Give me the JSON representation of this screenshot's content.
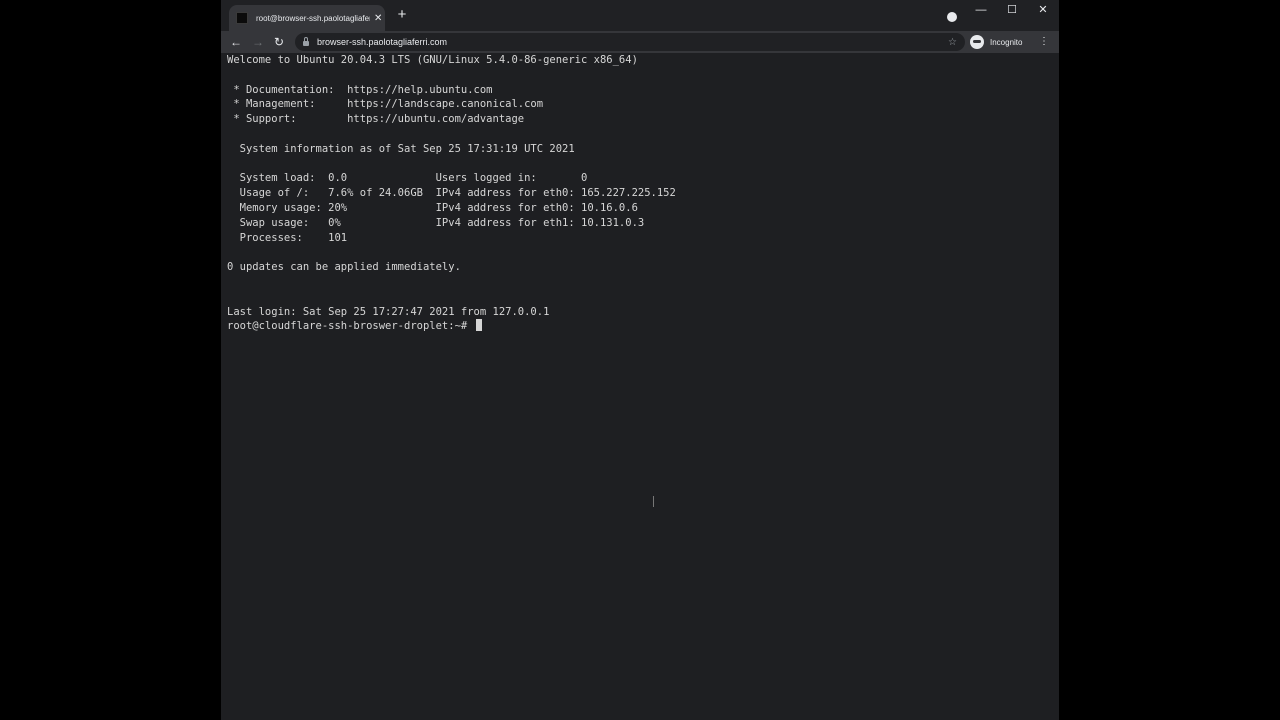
{
  "browser": {
    "tab_title": "root@browser-ssh.paolotagliaferri.com",
    "tab_close": "✕",
    "new_tab": "+",
    "url": "browser-ssh.paolotagliaferri.com",
    "incognito_label": "Incognito",
    "window_minimize": "—",
    "window_maximize": "☐",
    "window_close": "✕",
    "back": "←",
    "forward": "→",
    "reload": "↻",
    "star": "☆",
    "menu": "⋮"
  },
  "terminal": {
    "lines": [
      "Welcome to Ubuntu 20.04.3 LTS (GNU/Linux 5.4.0-86-generic x86_64)",
      "",
      " * Documentation:  https://help.ubuntu.com",
      " * Management:     https://landscape.canonical.com",
      " * Support:        https://ubuntu.com/advantage",
      "",
      "  System information as of Sat Sep 25 17:31:19 UTC 2021",
      "",
      "  System load:  0.0              Users logged in:       0",
      "  Usage of /:   7.6% of 24.06GB  IPv4 address for eth0: 165.227.225.152",
      "  Memory usage: 20%              IPv4 address for eth0: 10.16.0.6",
      "  Swap usage:   0%               IPv4 address for eth1: 10.131.0.3",
      "  Processes:    101",
      "",
      "0 updates can be applied immediately.",
      "",
      "",
      "Last login: Sat Sep 25 17:27:47 2021 from 127.0.0.1"
    ],
    "prompt": "root@cloudflare-ssh-broswer-droplet:~#"
  },
  "colors": {
    "terminal_bg": "#1e1f22",
    "terminal_fg": "#d6d6d6",
    "chrome_dark": "#202124",
    "chrome_toolbar": "#35363a"
  }
}
